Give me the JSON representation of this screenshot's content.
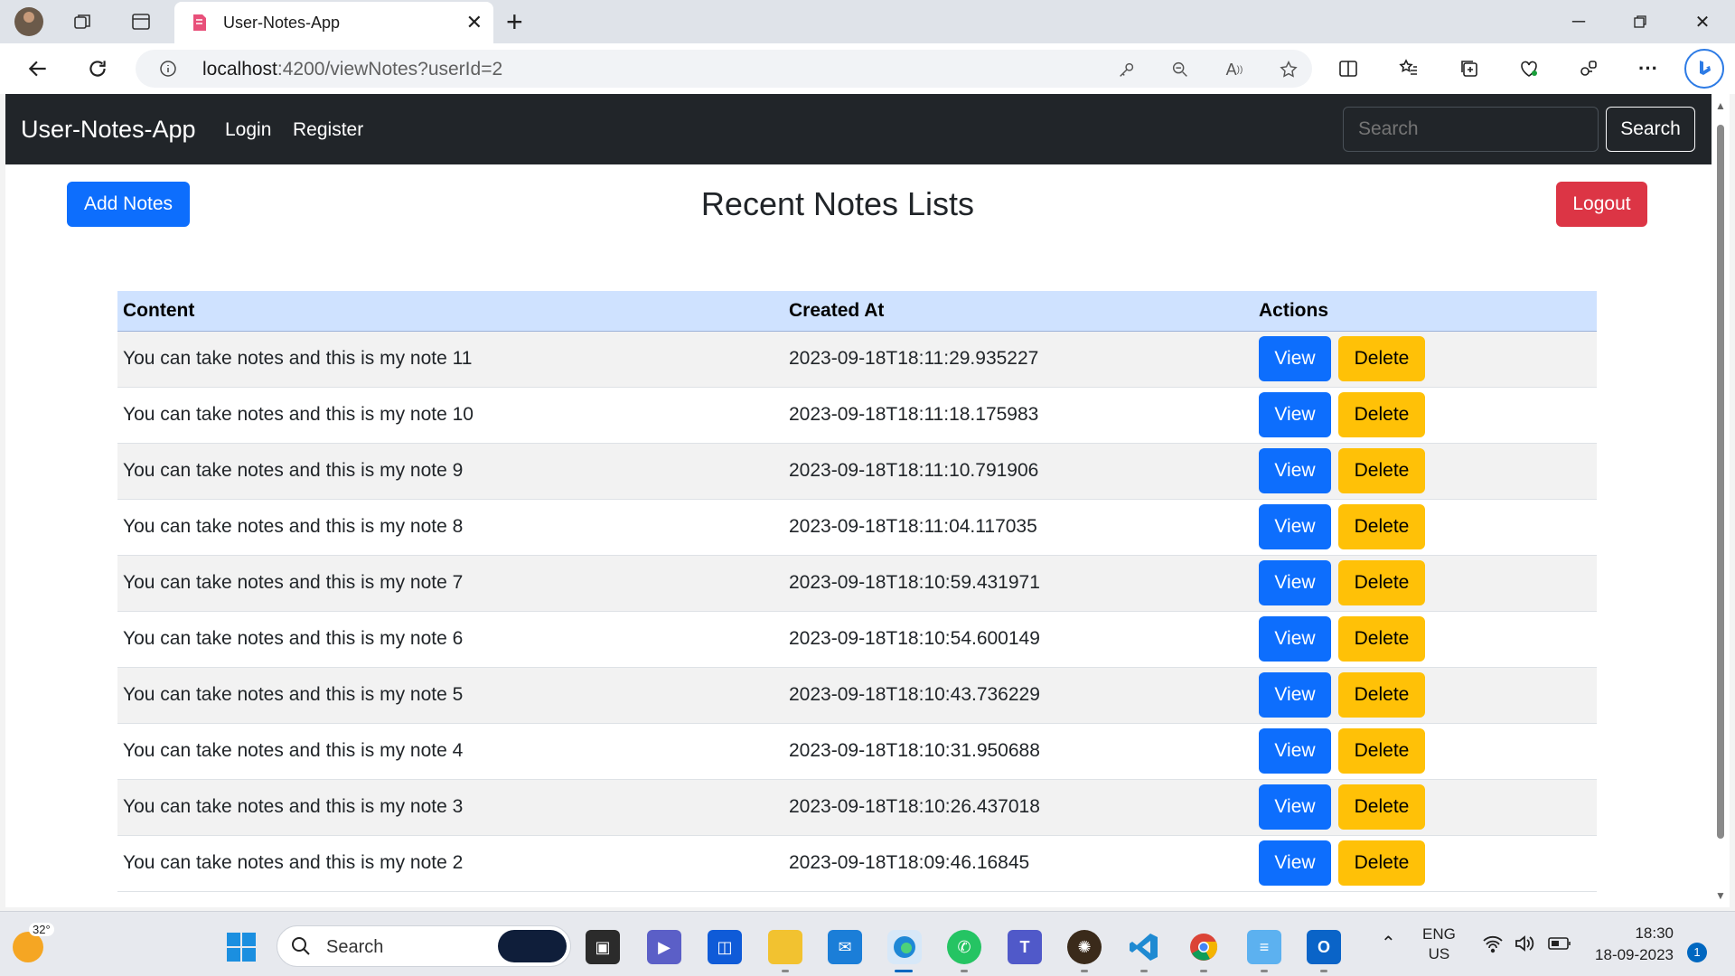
{
  "browser": {
    "tab_title": "User-Notes-App",
    "address_host": "localhost",
    "address_rest": ":4200/viewNotes?userId=2"
  },
  "navbar": {
    "brand": "User-Notes-App",
    "links": [
      "Login",
      "Register"
    ],
    "search_placeholder": "Search",
    "search_button": "Search"
  },
  "page": {
    "add_button": "Add Notes",
    "title": "Recent Notes Lists",
    "logout_button": "Logout"
  },
  "table": {
    "headers": [
      "Content",
      "Created At",
      "Actions"
    ],
    "view_label": "View",
    "delete_label": "Delete",
    "rows": [
      {
        "content": "You can take notes and this is my note 11",
        "created": "2023-09-18T18:11:29.935227"
      },
      {
        "content": "You can take notes and this is my note 10",
        "created": "2023-09-18T18:11:18.175983"
      },
      {
        "content": "You can take notes and this is my note 9",
        "created": "2023-09-18T18:11:10.791906"
      },
      {
        "content": "You can take notes and this is my note 8",
        "created": "2023-09-18T18:11:04.117035"
      },
      {
        "content": "You can take notes and this is my note 7",
        "created": "2023-09-18T18:10:59.431971"
      },
      {
        "content": "You can take notes and this is my note 6",
        "created": "2023-09-18T18:10:54.600149"
      },
      {
        "content": "You can take notes and this is my note 5",
        "created": "2023-09-18T18:10:43.736229"
      },
      {
        "content": "You can take notes and this is my note 4",
        "created": "2023-09-18T18:10:31.950688"
      },
      {
        "content": "You can take notes and this is my note 3",
        "created": "2023-09-18T18:10:26.437018"
      },
      {
        "content": "You can take notes and this is my note 2",
        "created": "2023-09-18T18:09:46.16845"
      }
    ]
  },
  "taskbar": {
    "weather_temp": "32°",
    "search_label": "Search",
    "lang_top": "ENG",
    "lang_bottom": "US",
    "time": "18:30",
    "date": "18-09-2023",
    "notification_count": "1"
  },
  "colors": {
    "primary": "#0d6efd",
    "danger": "#dc3545",
    "warning": "#ffc107",
    "navbar_bg": "#212529",
    "table_header_bg": "#cfe2ff"
  }
}
